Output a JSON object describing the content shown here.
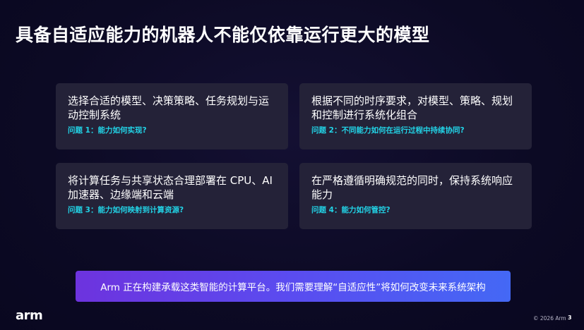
{
  "slide": {
    "title": "具备自适应能力的机器人不能仅依靠运行更大的模型",
    "cards": [
      {
        "text": "选择合适的模型、决策策略、任务规划与运动控制系统",
        "question": "问题 1：能力如何实现?"
      },
      {
        "text": "根据不同的时序要求，对模型、策略、规划和控制进行系统化组合",
        "question": "问题 2：不同能力如何在运行过程中持续协同?"
      },
      {
        "text": "将计算任务与共享状态合理部署在 CPU、AI 加速器、边缘端和云端",
        "question": "问题 3：能力如何映射到计算资源?"
      },
      {
        "text": "在严格遵循明确规范的同时，保持系统响应能力",
        "question": "问题 4：能力如何管控?"
      }
    ],
    "banner": "Arm 正在构建承载这类智能的计算平台。我们需要理解“自适应性”将如何改变未来系统架构",
    "logo": "arm",
    "copyright": "© 2026 Arm",
    "page_number": "3"
  },
  "colors": {
    "background": "#0c0a24",
    "card": "#242238",
    "question": "#22d3e6",
    "banner_start": "#6d33de",
    "banner_end": "#4468f5"
  }
}
